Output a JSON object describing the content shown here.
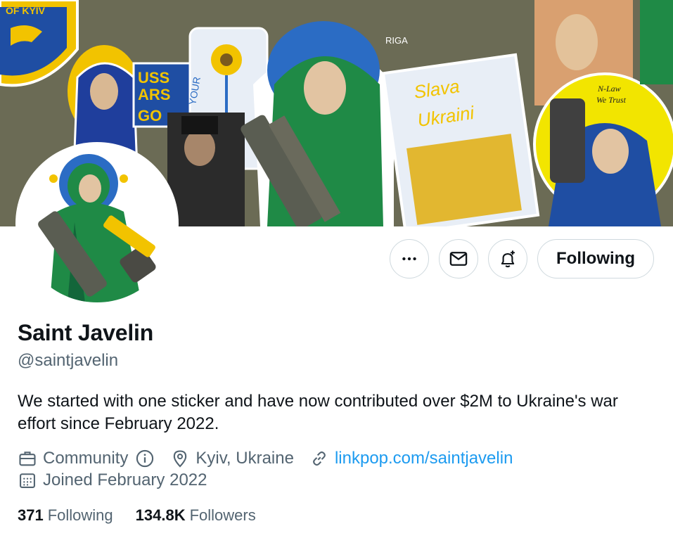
{
  "profile": {
    "name": "Saint Javelin",
    "handle": "@saintjavelin",
    "bio": "We started with one sticker and have now contributed over $2M to Ukraine's war effort since February 2022.",
    "category": "Community",
    "location": "Kyiv, Ukraine",
    "website": "linkpop.com/saintjavelin",
    "joined": "Joined February 2022"
  },
  "banner": {
    "sticker_texts": [
      "OF KYIV",
      "USS",
      "ARS",
      "GO",
      "YOUR",
      "Slava",
      "Ukraini",
      "RIGA",
      "N-Law",
      "We Trust"
    ]
  },
  "actions": {
    "more_icon": "more-icon",
    "message_icon": "envelope-icon",
    "notify_icon": "bell-plus-icon",
    "follow_label": "Following"
  },
  "stats": {
    "following_count": "371",
    "following_label": "Following",
    "followers_count": "134.8K",
    "followers_label": "Followers"
  },
  "colors": {
    "link": "#1d9bf0",
    "secondary_text": "#536471",
    "primary_text": "#0f1419",
    "border": "#cfd9de"
  }
}
